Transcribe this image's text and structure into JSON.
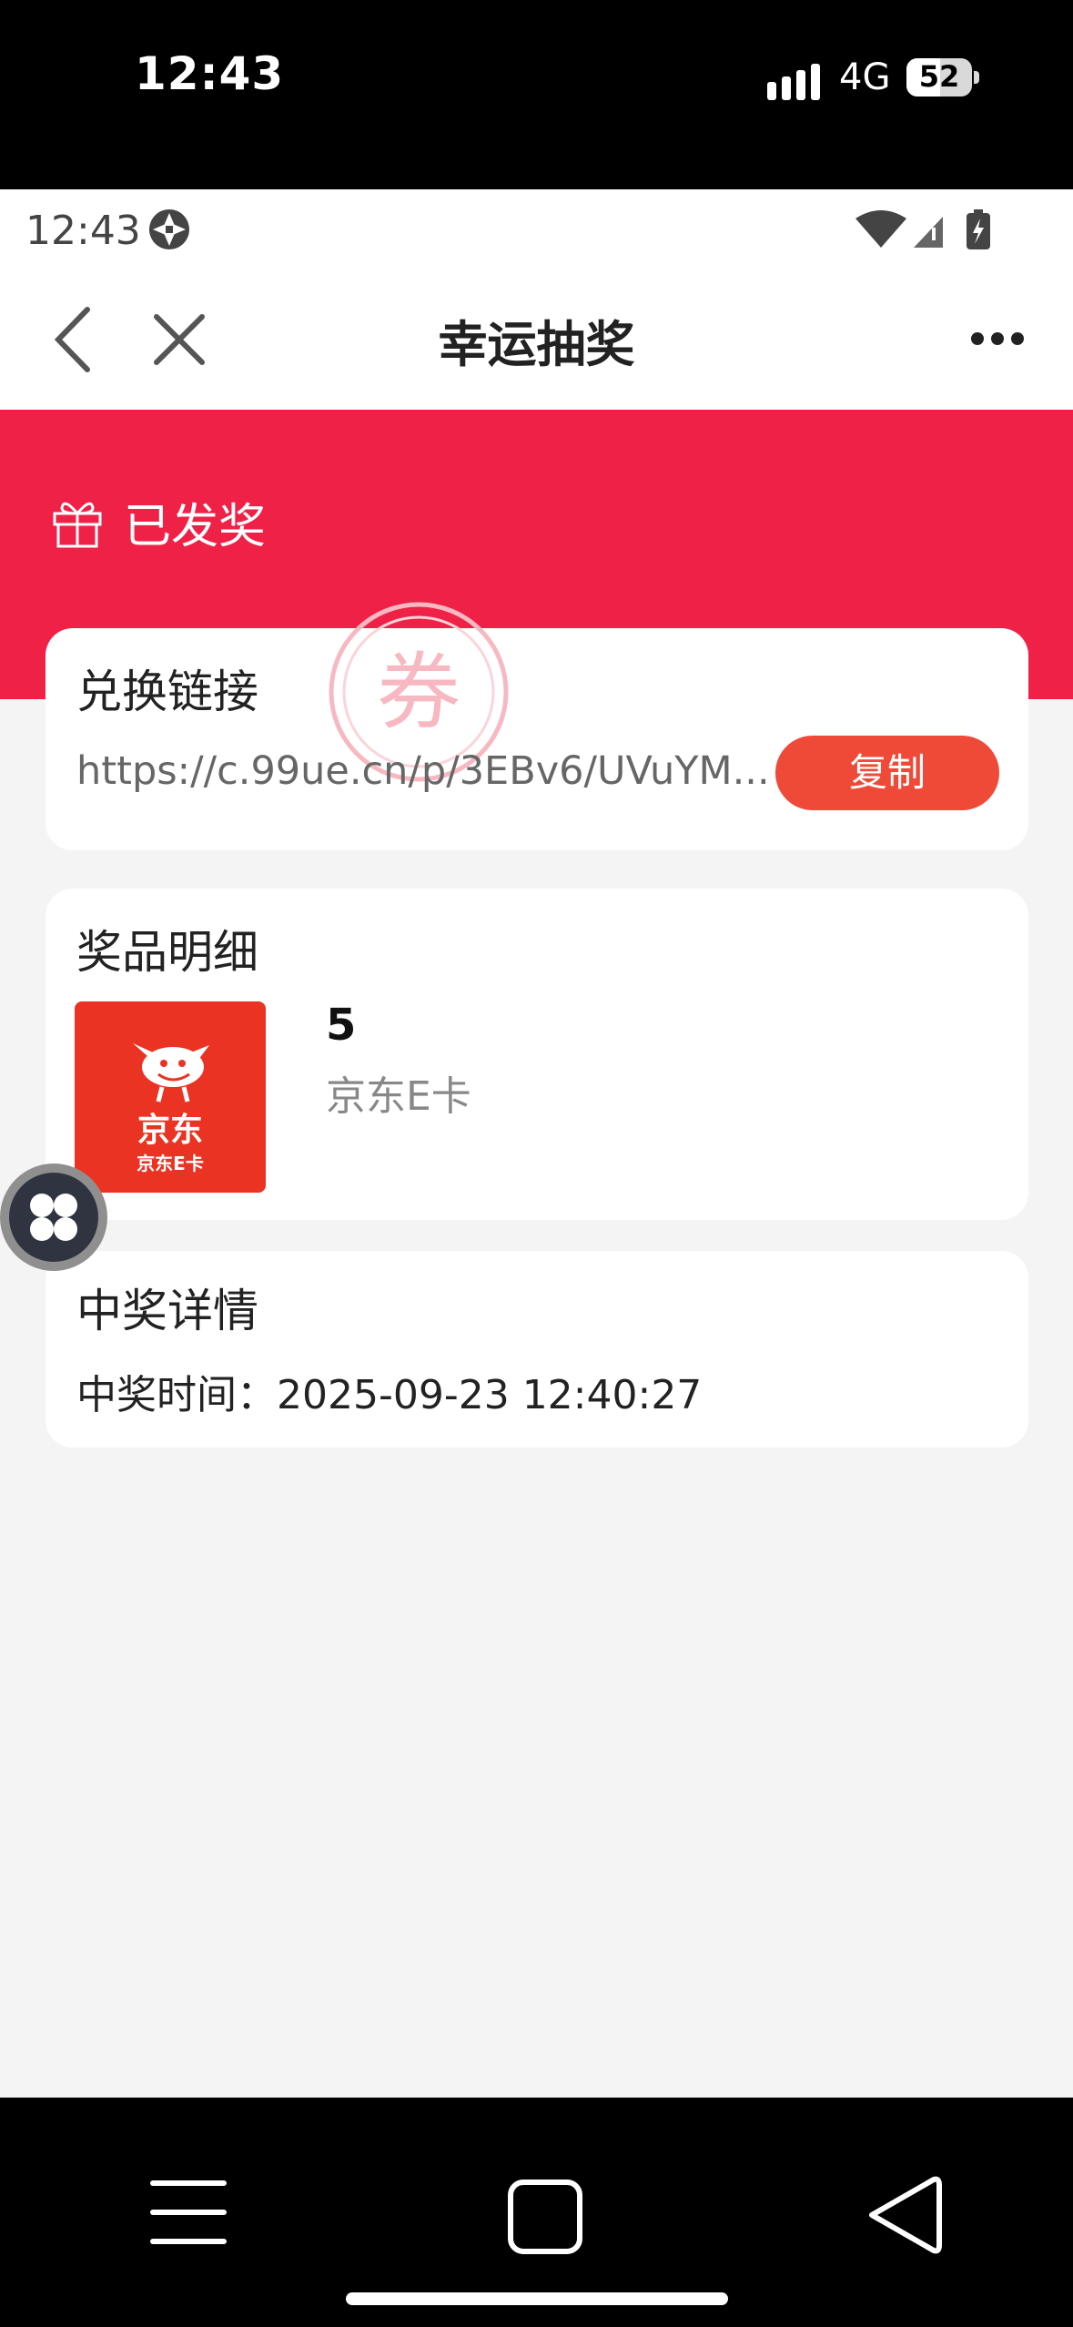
{
  "ios_status": {
    "time": "12:43",
    "network": "4G",
    "battery": "52"
  },
  "android_status": {
    "time": "12:43"
  },
  "nav": {
    "title": "幸运抽奖"
  },
  "banner": {
    "status": "已发奖"
  },
  "redeem_card": {
    "title": "兑换链接",
    "link": "https://c.99ue.cn/p/3EBv6/UVuYM...",
    "copy_label": "复制",
    "stamp_text": "券"
  },
  "prize_card": {
    "title": "奖品明细",
    "value": "5",
    "name": "京东E卡",
    "logo_brand": "京东",
    "logo_sub": "京东E卡"
  },
  "win_card": {
    "title": "中奖详情",
    "time_line": "中奖时间：2025-09-23 12:40:27"
  },
  "colors": {
    "accent_red": "#f02147",
    "copy_button": "#ef4a38",
    "jd_red": "#ea3323"
  }
}
